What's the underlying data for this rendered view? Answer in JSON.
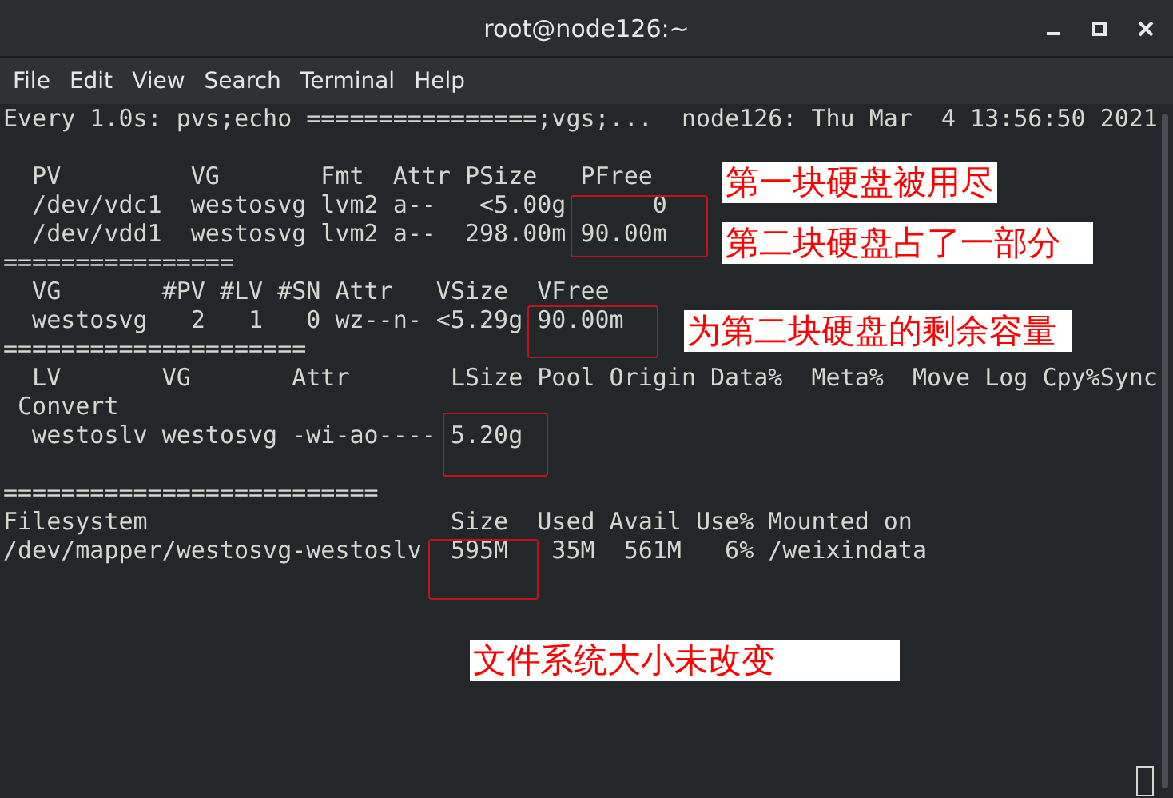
{
  "window": {
    "title": "root@node126:~"
  },
  "menu": [
    "File",
    "Edit",
    "View",
    "Search",
    "Terminal",
    "Help"
  ],
  "terminal": {
    "blocks": [
      [
        "Every 1.0s: pvs;echo ================;vgs;...  node126: Thu Mar  4 13:56:50 2021"
      ],
      [
        "  PV         VG       Fmt  Attr PSize   PFree",
        "  /dev/vdc1  westosvg lvm2 a--   <5.00g      0",
        "  /dev/vdd1  westosvg lvm2 a--  298.00m 90.00m",
        "================",
        "  VG       #PV #LV #SN Attr   VSize  VFree",
        "  westosvg   2   1   0 wz--n- <5.29g 90.00m",
        "=====================",
        "  LV       VG       Attr       LSize Pool Origin Data%  Meta%  Move Log Cpy%Sync",
        " Convert",
        "  westoslv westosvg -wi-ao---- 5.20g"
      ],
      [
        "==========================",
        "Filesystem                     Size  Used Avail Use% Mounted on",
        "/dev/mapper/westosvg-westoslv  595M   35M  561M   6% /weixindata"
      ]
    ]
  },
  "annotations": [
    "第一块硬盘被用尽",
    "第二块硬盘占了一部分",
    "为第二块硬盘的剩余容量",
    "文件系统大小未改变"
  ]
}
